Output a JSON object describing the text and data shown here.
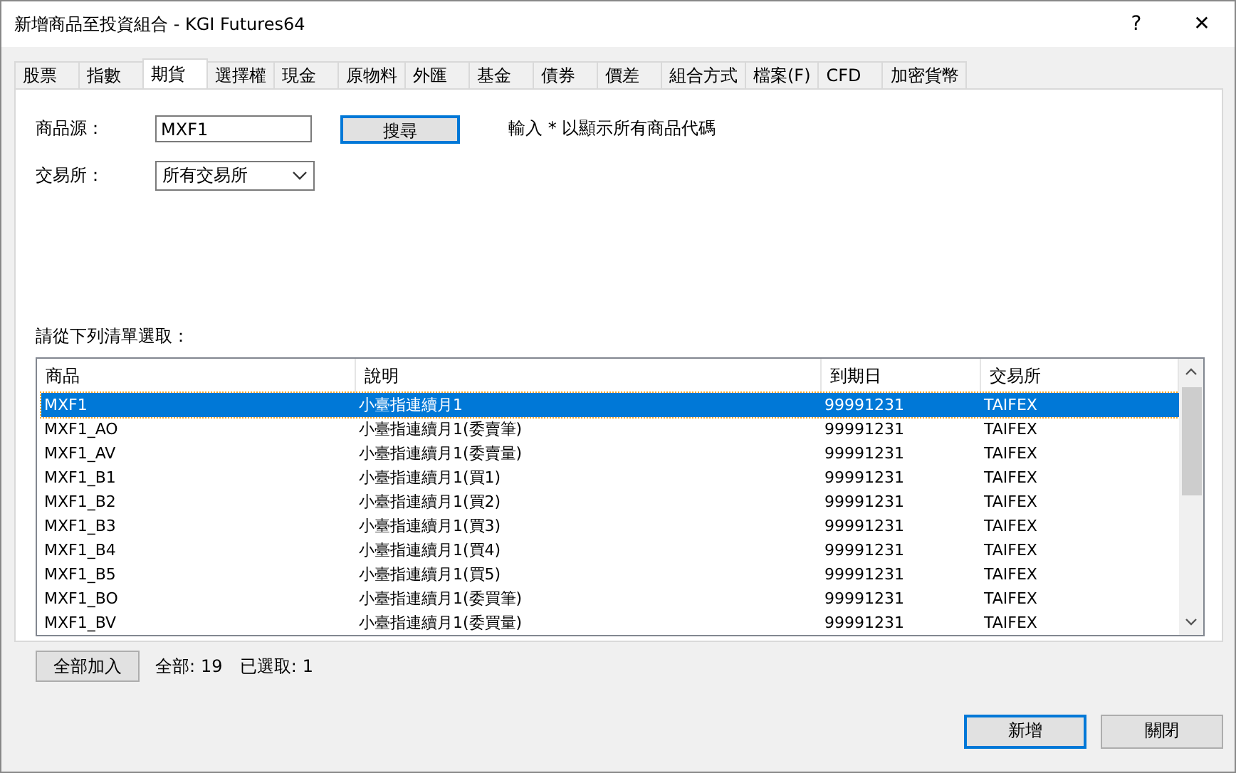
{
  "window": {
    "title": "新增商品至投資組合 - KGI Futures64",
    "help": "?",
    "close": "✕"
  },
  "tabs": [
    {
      "label": "股票",
      "selected": false
    },
    {
      "label": "指數",
      "selected": false
    },
    {
      "label": "期貨",
      "selected": true
    },
    {
      "label": "選擇權",
      "selected": false
    },
    {
      "label": "現金",
      "selected": false
    },
    {
      "label": "原物料",
      "selected": false
    },
    {
      "label": "外匯",
      "selected": false
    },
    {
      "label": "基金",
      "selected": false
    },
    {
      "label": "債券",
      "selected": false
    },
    {
      "label": "價差",
      "selected": false
    },
    {
      "label": "組合方式",
      "selected": false
    },
    {
      "label": "檔案(F)",
      "selected": false
    },
    {
      "label": "CFD",
      "selected": false
    },
    {
      "label": "加密貨幣",
      "selected": false
    }
  ],
  "source": {
    "label": "商品源：",
    "value": "MXF1",
    "search_button": "搜尋",
    "hint": "輸入 * 以顯示所有商品代碼"
  },
  "exchange": {
    "label": "交易所：",
    "value": "所有交易所"
  },
  "list_label": "請從下列清單選取：",
  "table": {
    "columns": [
      "商品",
      "說明",
      "到期日",
      "交易所"
    ],
    "rows": [
      {
        "cells": [
          "MXF1",
          "小臺指連續月1",
          "99991231",
          "TAIFEX"
        ],
        "selected": true
      },
      {
        "cells": [
          "MXF1_AO",
          "小臺指連續月1(委賣筆)",
          "99991231",
          "TAIFEX"
        ],
        "selected": false
      },
      {
        "cells": [
          "MXF1_AV",
          "小臺指連續月1(委賣量)",
          "99991231",
          "TAIFEX"
        ],
        "selected": false
      },
      {
        "cells": [
          "MXF1_B1",
          "小臺指連續月1(買1)",
          "99991231",
          "TAIFEX"
        ],
        "selected": false
      },
      {
        "cells": [
          "MXF1_B2",
          "小臺指連續月1(買2)",
          "99991231",
          "TAIFEX"
        ],
        "selected": false
      },
      {
        "cells": [
          "MXF1_B3",
          "小臺指連續月1(買3)",
          "99991231",
          "TAIFEX"
        ],
        "selected": false
      },
      {
        "cells": [
          "MXF1_B4",
          "小臺指連續月1(買4)",
          "99991231",
          "TAIFEX"
        ],
        "selected": false
      },
      {
        "cells": [
          "MXF1_B5",
          "小臺指連續月1(買5)",
          "99991231",
          "TAIFEX"
        ],
        "selected": false
      },
      {
        "cells": [
          "MXF1_BO",
          "小臺指連續月1(委買筆)",
          "99991231",
          "TAIFEX"
        ],
        "selected": false
      },
      {
        "cells": [
          "MXF1_BV",
          "小臺指連續月1(委買量)",
          "99991231",
          "TAIFEX"
        ],
        "selected": false
      }
    ]
  },
  "add_all_button": "全部加入",
  "total_label": "全部:",
  "total": "19",
  "selected_label": "已選取:",
  "selected_count": "1",
  "buttons": [
    {
      "label": "新增",
      "selected": true
    },
    {
      "label": "關閉",
      "selected": false
    }
  ]
}
